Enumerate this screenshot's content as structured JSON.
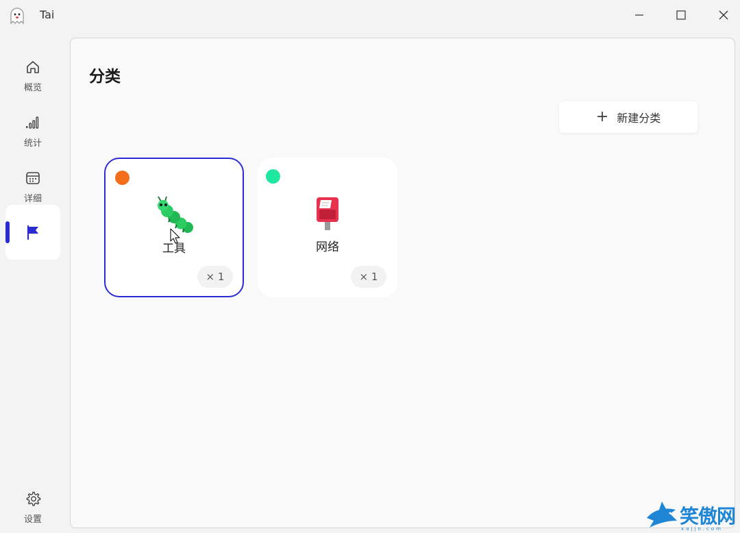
{
  "window": {
    "title": "Tai",
    "icon": "ghost-icon"
  },
  "sidebar": {
    "items": [
      {
        "label": "概览",
        "icon": "home-icon"
      },
      {
        "label": "统计",
        "icon": "signal-bars-icon"
      },
      {
        "label": "详细",
        "icon": "calendar-icon"
      },
      {
        "label": "",
        "icon": "flag-icon",
        "active": true
      },
      {
        "label": "设置",
        "icon": "gear-icon"
      }
    ],
    "accent": "#2b2bd4"
  },
  "main": {
    "page_title": "分类",
    "new_button_label": "新建分类",
    "categories": [
      {
        "name": "工具",
        "color": "#f36d1a",
        "icon": "caterpillar-icon",
        "count": "× 1",
        "selected": true
      },
      {
        "name": "网络",
        "color": "#1ee8a0",
        "icon": "mailbox-icon",
        "count": "× 1",
        "selected": false
      }
    ]
  },
  "watermark": {
    "text": "笑傲网",
    "sub": "xajjn.com"
  }
}
